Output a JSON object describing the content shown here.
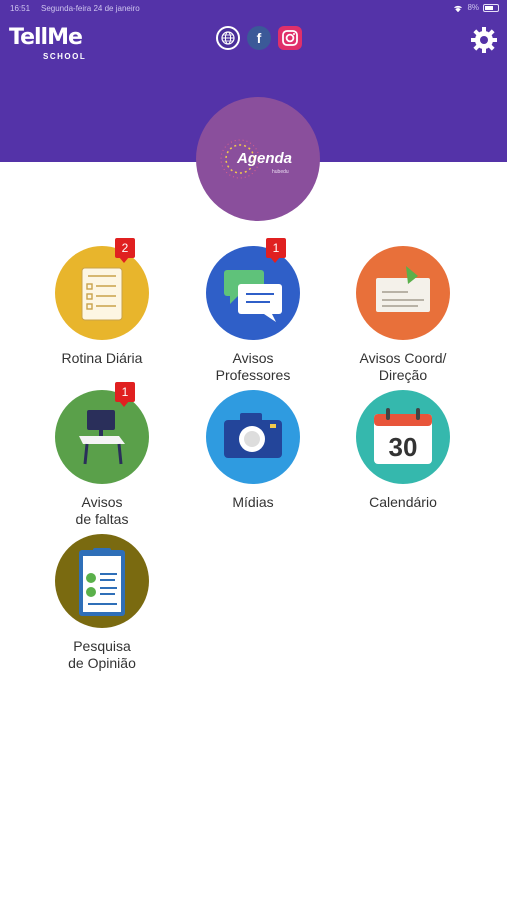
{
  "status_bar": {
    "time": "16:51",
    "date": "Segunda-feira 24 de janeiro",
    "battery": "8%"
  },
  "header": {
    "logo_title": "TellMe",
    "logo_subtitle": "SCHOOL",
    "social_icons": [
      "globe-icon",
      "facebook-icon",
      "instagram-icon"
    ],
    "facebook_letter": "f"
  },
  "agenda": {
    "title": "Agenda",
    "subtitle": "hubedu"
  },
  "colors": {
    "header_bg": "#5433a8",
    "agenda_bg": "#8a4f9c",
    "badge": "#e02020",
    "rotina": "#e8b52c",
    "avisos_prof": "#2f5fc8",
    "avisos_coord": "#e8703a",
    "avisos_faltas": "#5aa04a",
    "midias": "#2f9be0",
    "calendario": "#35b8ad",
    "pesquisa": "#7a6a10"
  },
  "tiles": [
    {
      "label": "Rotina Diária",
      "badge": "2",
      "icon": "checklist-icon"
    },
    {
      "label1": "Avisos",
      "label2": "Professores",
      "badge": "1",
      "icon": "chat-bubbles-icon"
    },
    {
      "label1": "Avisos Coord/",
      "label2": "Direção",
      "icon": "envelope-icon"
    },
    {
      "label1": "Avisos",
      "label2": "de faltas",
      "badge": "1",
      "icon": "school-desk-icon"
    },
    {
      "label": "Mídias",
      "icon": "camera-icon"
    },
    {
      "label": "Calendário",
      "icon": "calendar-icon",
      "day": "30"
    },
    {
      "label1": "Pesquisa",
      "label2": "de Opinião",
      "icon": "survey-clipboard-icon"
    }
  ]
}
